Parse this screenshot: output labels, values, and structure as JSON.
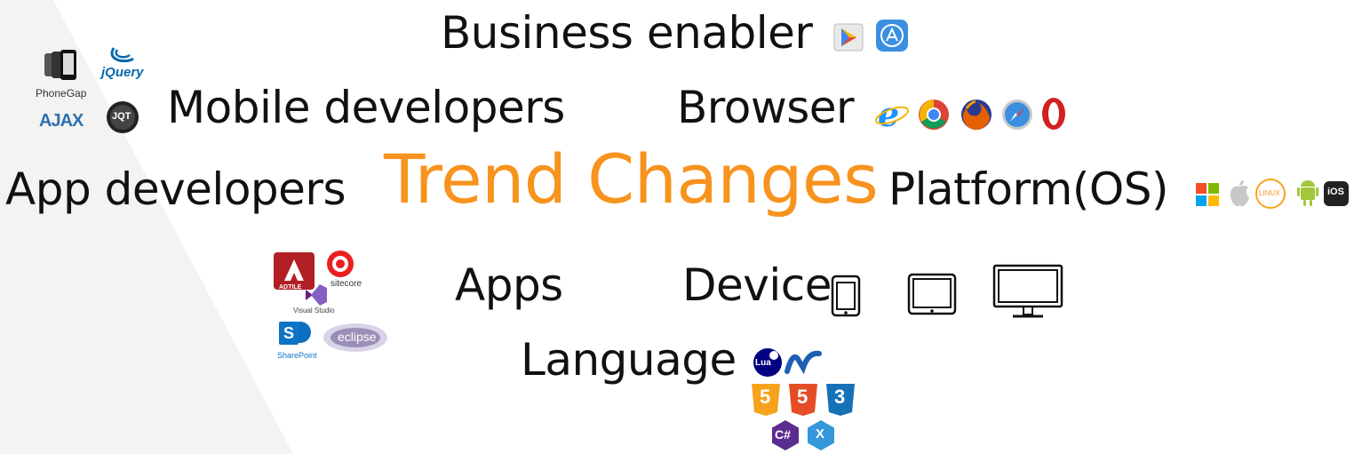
{
  "words": {
    "business_enabler": "Business enabler",
    "mobile_developers": "Mobile developers",
    "browser": "Browser",
    "app_developers": "App developers",
    "trend_changes": "Trend Changes",
    "platform": "Platform(OS)",
    "apps": "Apps",
    "device": "Device",
    "language": "Language"
  },
  "logos": {
    "jquery": "jQuery",
    "phonegap": "PhoneGap",
    "ajax": "AJAX",
    "jqt": "JQT",
    "adtile": "ADTILE",
    "sitecore": "sitecore",
    "visual_studio": "Visual Studio",
    "sharepoint": "SharePoint",
    "sharepoint_letter": "S",
    "eclipse": "eclipse",
    "linux": "LINUX",
    "ios": "iOS",
    "lua": "Lua",
    "html5": "5",
    "css3": "3",
    "csharp": "C#",
    "xamarin": "X"
  },
  "colors": {
    "accent": "#f7931e",
    "text": "#111111",
    "background_shape": "#f2f2f2"
  }
}
